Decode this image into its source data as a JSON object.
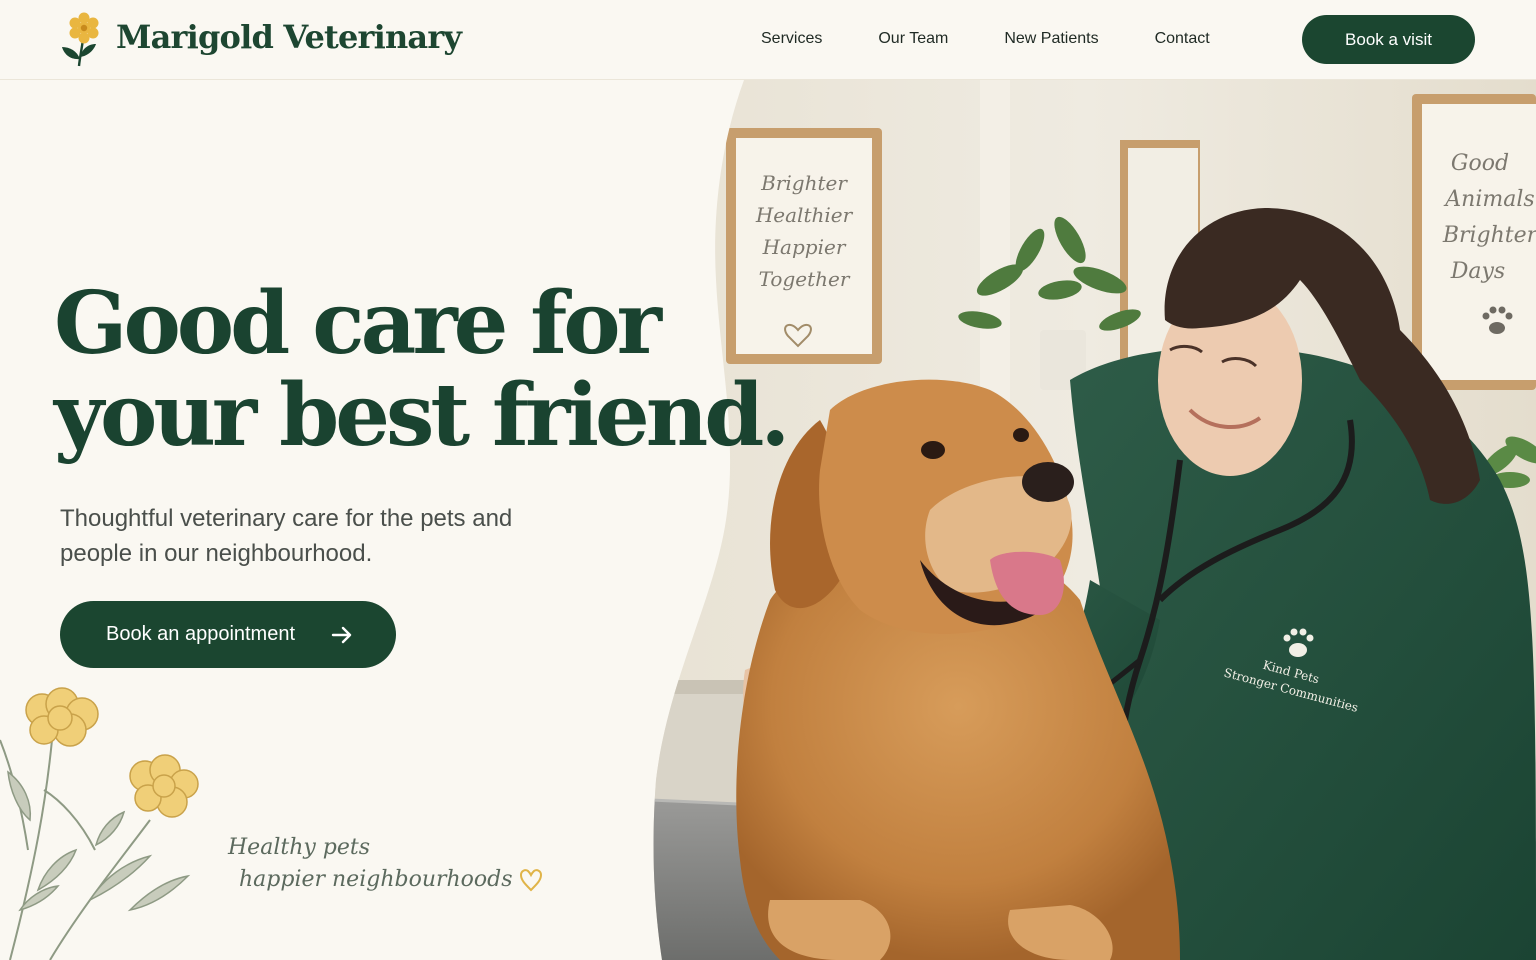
{
  "brand": {
    "name": "Marigold Veterinary"
  },
  "nav": {
    "items": [
      {
        "label": "Services"
      },
      {
        "label": "Our Team"
      },
      {
        "label": "New Patients"
      },
      {
        "label": "Contact"
      }
    ],
    "cta_label": "Book a visit"
  },
  "hero": {
    "headline_line1": "Good care for",
    "headline_line2": "your best friend.",
    "subhead": "Thoughtful veterinary care for the pets and people in our neighbourhood.",
    "cta_label": "Book an appointment",
    "tagline_line1": "Healthy pets",
    "tagline_line2": "happier neighbourhoods"
  },
  "photo": {
    "poster_left": {
      "lines": [
        "Brighter",
        "Healthier",
        "Happier",
        "Together"
      ]
    },
    "poster_right": {
      "lines": [
        "Good",
        "Animals",
        "Brighter",
        "Days"
      ]
    },
    "scrub_logo": {
      "lines": [
        "Kind Pets",
        "Stronger Communities"
      ]
    }
  },
  "colors": {
    "brand_green": "#1b4630",
    "page_bg": "#faf8f2",
    "accent_gold": "#e9b640"
  },
  "icons": {
    "logo": "marigold-flower-icon",
    "cta_arrow": "arrow-right-icon",
    "tagline_heart": "heart-icon"
  }
}
